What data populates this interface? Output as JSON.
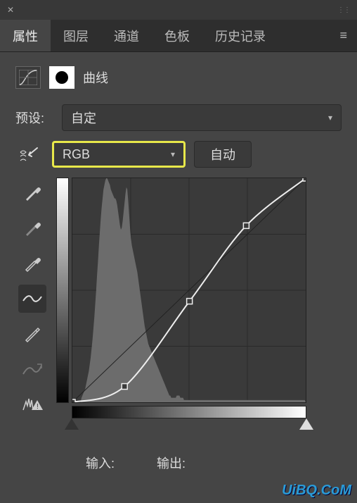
{
  "tabs": {
    "items": [
      "属性",
      "图层",
      "通道",
      "色板",
      "历史记录"
    ],
    "active_index": 0
  },
  "header": {
    "title": "曲线"
  },
  "preset": {
    "label": "预设:",
    "value": "自定"
  },
  "channel": {
    "value": "RGB",
    "auto_label": "自动"
  },
  "io": {
    "input_label": "输入:",
    "output_label": "输出:"
  },
  "watermark": "UiBQ.CoM",
  "chart_data": {
    "type": "curve",
    "title": "曲线",
    "xlabel": "输入",
    "ylabel": "输出",
    "xlim": [
      0,
      255
    ],
    "ylim": [
      0,
      255
    ],
    "baseline": [
      [
        0,
        0
      ],
      [
        255,
        255
      ]
    ],
    "curve_points": [
      {
        "x": 0,
        "y": 0
      },
      {
        "x": 57,
        "y": 18
      },
      {
        "x": 128,
        "y": 115
      },
      {
        "x": 190,
        "y": 201
      },
      {
        "x": 255,
        "y": 255
      }
    ],
    "histogram": [
      0,
      0,
      0,
      0,
      0,
      0,
      0,
      0,
      0,
      0,
      2,
      3,
      4,
      5,
      6,
      8,
      10,
      12,
      14,
      17,
      20,
      24,
      28,
      33,
      38,
      44,
      50,
      57,
      63,
      70,
      76,
      82,
      87,
      91,
      95,
      97,
      99,
      100,
      100,
      99,
      98,
      97,
      95,
      94,
      93,
      92,
      91,
      91,
      90,
      88,
      85,
      82,
      79,
      77,
      78,
      81,
      85,
      89,
      93,
      96,
      95,
      90,
      84,
      78,
      73,
      70,
      68,
      66,
      64,
      62,
      60,
      58,
      55,
      52,
      49,
      46,
      43,
      40,
      37,
      34,
      32,
      30,
      28,
      26,
      25,
      24,
      23,
      22,
      21,
      20,
      19,
      18,
      17,
      16,
      15,
      14,
      13,
      12,
      11,
      10,
      9,
      8,
      7,
      6,
      5,
      4,
      3,
      3,
      2,
      2,
      2,
      2,
      2,
      2,
      3,
      3,
      3,
      3,
      2,
      2,
      2,
      2,
      1,
      1,
      1,
      1,
      1,
      1,
      1,
      1,
      1,
      1,
      1,
      1,
      1,
      1,
      1,
      1,
      1,
      1,
      1,
      1,
      1,
      1,
      1,
      1,
      1,
      1,
      1,
      1,
      1,
      1,
      1,
      1,
      1,
      1,
      1,
      1,
      1,
      1,
      1,
      1,
      1,
      1,
      1,
      1,
      1,
      1,
      1,
      1,
      1,
      1,
      1,
      1,
      1,
      1,
      1,
      1,
      1,
      1,
      1,
      1,
      1,
      1,
      1,
      1,
      1,
      1,
      1,
      1,
      1,
      1,
      1,
      1,
      1,
      1,
      1,
      1,
      1,
      1,
      1,
      1,
      1,
      1,
      1,
      1,
      1,
      1,
      1,
      1,
      1,
      1,
      1,
      1,
      1,
      1,
      1,
      1,
      1,
      1,
      1,
      1,
      1,
      1,
      1,
      1,
      1,
      1,
      1,
      1,
      1,
      1,
      1,
      1,
      1,
      1,
      1,
      1,
      1,
      1,
      1,
      1,
      1,
      1,
      1,
      1,
      1,
      1,
      1,
      1,
      1,
      1,
      1,
      1,
      1,
      0
    ]
  }
}
